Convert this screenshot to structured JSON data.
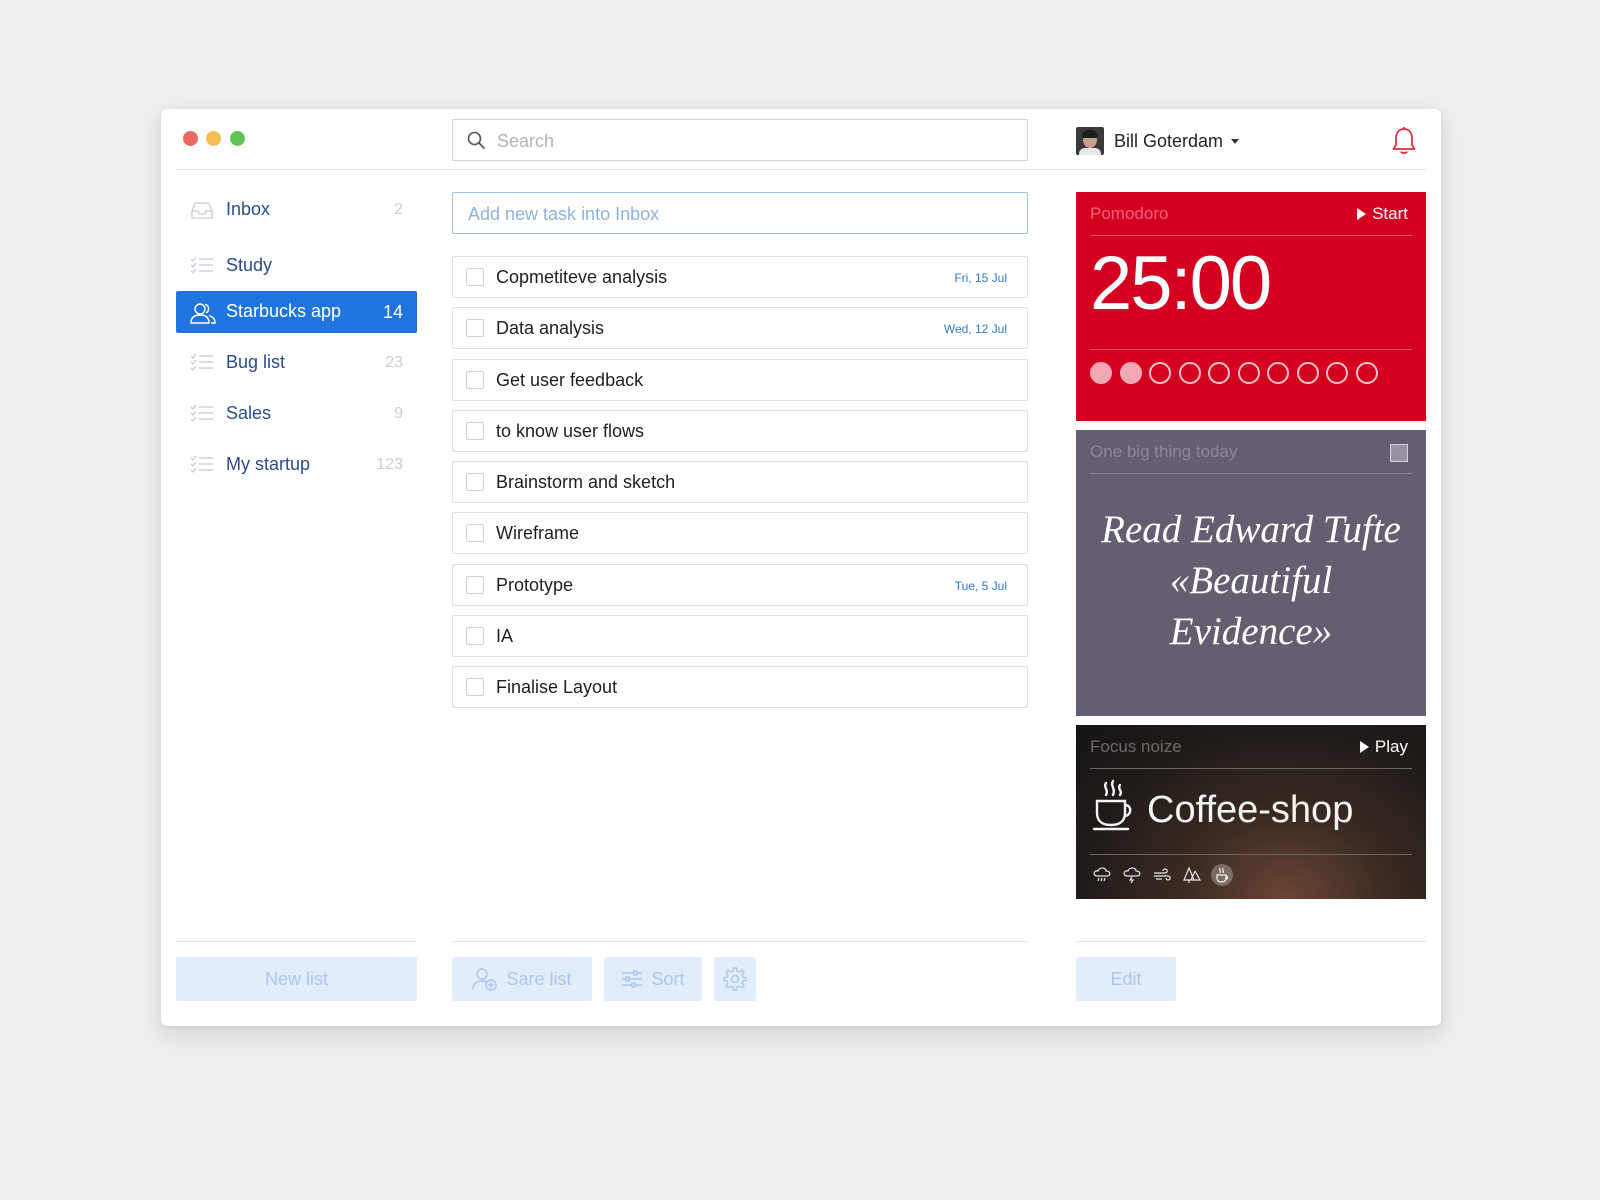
{
  "window": {
    "controls": [
      "close",
      "minimize",
      "maximize"
    ]
  },
  "search": {
    "placeholder": "Search",
    "value": ""
  },
  "user": {
    "name": "Bill Goterdam"
  },
  "sidebar": {
    "items": [
      {
        "label": "Inbox",
        "count": "2",
        "icon": "inbox-icon"
      },
      {
        "label": "Study",
        "count": "",
        "icon": "list-icon"
      },
      {
        "label": "Starbucks app",
        "count": "14",
        "icon": "users-icon",
        "active": true
      },
      {
        "label": "Bug list",
        "count": "23",
        "icon": "list-icon"
      },
      {
        "label": "Sales",
        "count": "9",
        "icon": "list-icon"
      },
      {
        "label": "My startup",
        "count": "123",
        "icon": "list-icon"
      }
    ],
    "new_list_label": "New list"
  },
  "tasks": {
    "add_placeholder": "Add new task into Inbox",
    "items": [
      {
        "title": "Copmetiteve analysis",
        "due": "Fri, 15 Jul"
      },
      {
        "title": "Data analysis",
        "due": "Wed, 12 Jul"
      },
      {
        "title": "Get user feedback",
        "due": ""
      },
      {
        "title": "to know user flows",
        "due": ""
      },
      {
        "title": "Brainstorm and sketch",
        "due": ""
      },
      {
        "title": "Wireframe",
        "due": ""
      },
      {
        "title": "Prototype",
        "due": "Tue, 5 Jul"
      },
      {
        "title": "IA",
        "due": ""
      },
      {
        "title": "Finalise Layout",
        "due": ""
      }
    ]
  },
  "footer": {
    "share_label": "Sare list",
    "sort_label": "Sort",
    "edit_label": "Edit"
  },
  "pomodoro": {
    "label": "Pomodoro",
    "action": "Start",
    "time": "25:00",
    "completed": 2,
    "total": 10
  },
  "big_thing": {
    "label": "One big thing today",
    "text": "Read Edward Tufte «Beautiful Evidence»"
  },
  "focus": {
    "label": "Focus noize",
    "action": "Play",
    "sound": "Coffee-shop",
    "sounds": [
      "rain-icon",
      "thunder-icon",
      "wind-icon",
      "forest-icon",
      "coffee-icon"
    ],
    "active_sound": "coffee-icon"
  },
  "colors": {
    "accent": "#1f75dd",
    "pomodoro_bg": "#d40020",
    "big_thing_bg": "#655e70",
    "due_date": "#2d7bd6",
    "bell": "#e0283c"
  }
}
